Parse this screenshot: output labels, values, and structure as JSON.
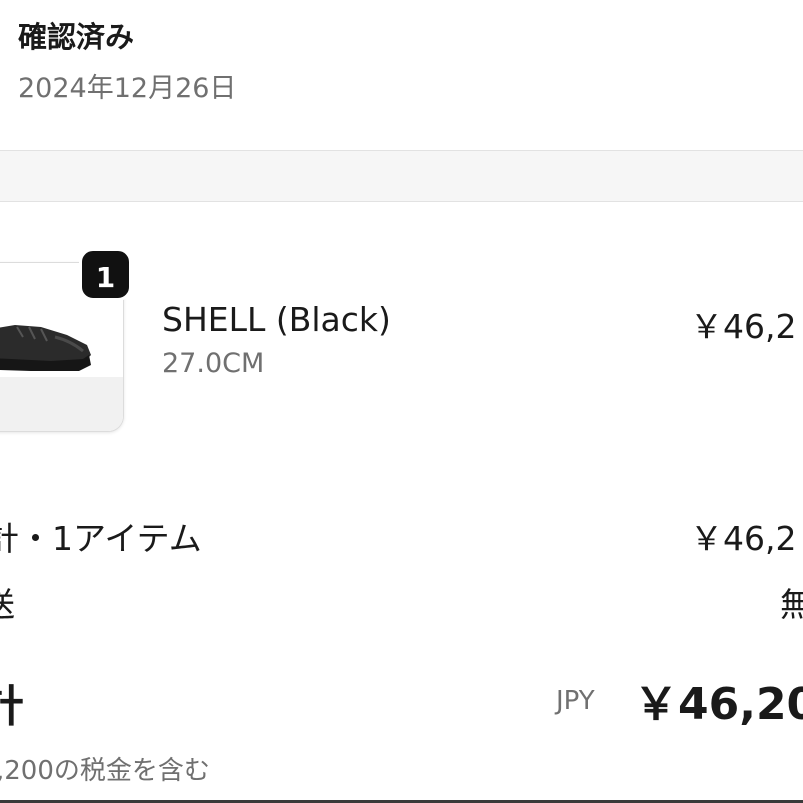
{
  "header": {
    "status": "確認済み",
    "date": "2024年12月26日"
  },
  "line_item": {
    "quantity_badge": "1",
    "name": "SHELL (Black)",
    "variant": "27.0CM",
    "price": "￥46,2",
    "image_icon": "shoe-product-image"
  },
  "summary": {
    "subtotal_label": "計・1アイテム",
    "subtotal_value": "￥46,2",
    "shipping_label": "送",
    "shipping_value": "無",
    "total_label": "計",
    "currency": "JPY",
    "total_value": "￥46,20",
    "tax_note": ",200の税金を含む"
  },
  "colors": {
    "text": "#1a1a1a",
    "muted": "#707070",
    "band": "#f6f6f6",
    "badge": "#111111"
  }
}
